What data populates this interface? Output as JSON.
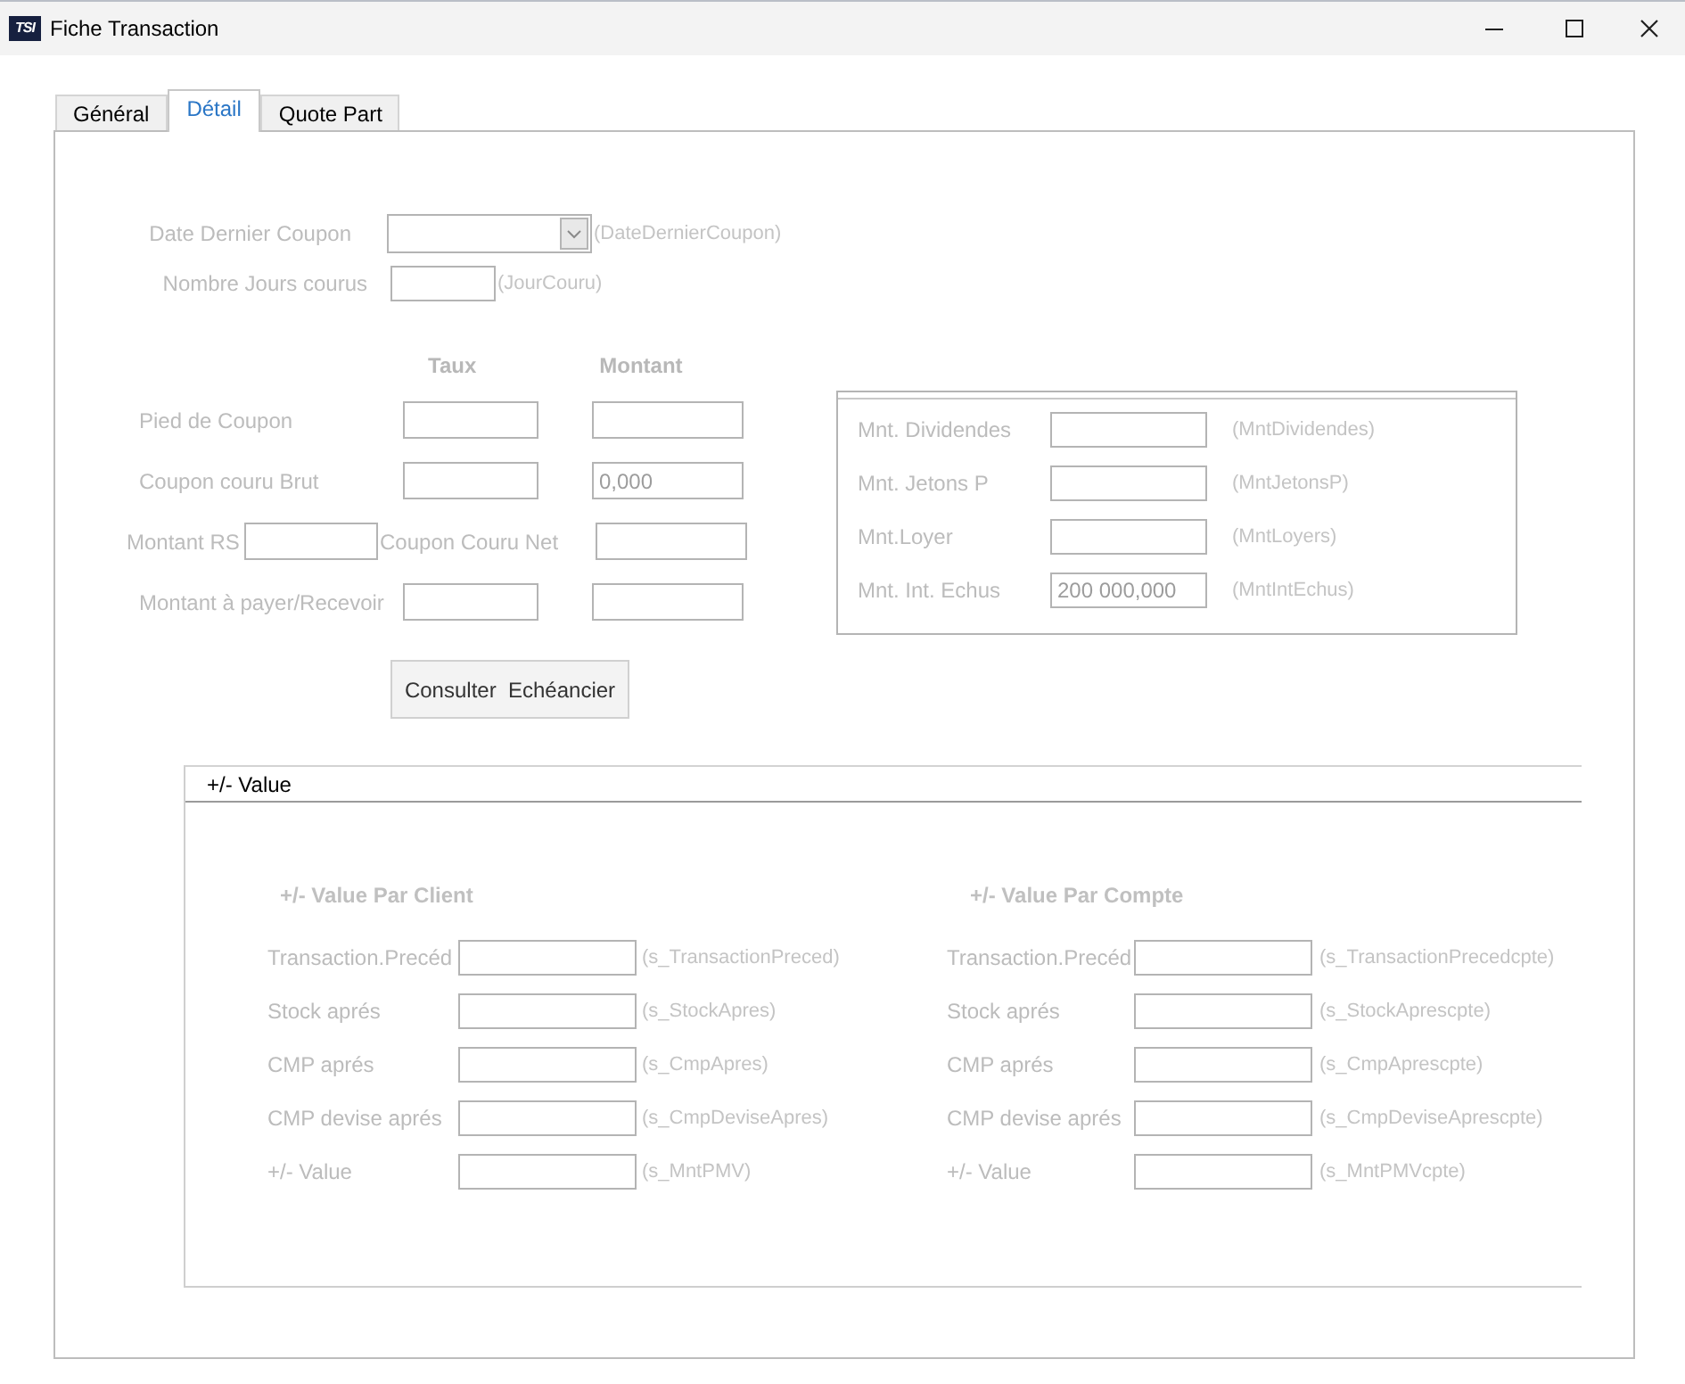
{
  "window": {
    "logo": "TSI",
    "title": "Fiche Transaction"
  },
  "tabs": [
    {
      "label": "Général",
      "selected": false
    },
    {
      "label": "Détail",
      "selected": true
    },
    {
      "label": "Quote Part",
      "selected": false
    }
  ],
  "detail_panel": {
    "disabled": true,
    "date_dernier_coupon": {
      "label": "Date Dernier Coupon",
      "field": {
        "disabled": true
      },
      "hint": "(DateDernierCoupon)"
    },
    "jours_courus": {
      "label": "Nombre Jours courus",
      "field": {
        "disabled": true
      },
      "hint": "(JourCouru)"
    },
    "columns": [
      "Taux",
      "Montant"
    ],
    "coupon_rows": [
      {
        "kind": "standard",
        "label": "Pied de Coupon",
        "field_1": {
          "disabled": true
        },
        "field_2": {
          "disabled": true
        }
      },
      {
        "kind": "standard",
        "label": "Coupon couru Brut",
        "field_1": {
          "disabled": true
        },
        "field_2": {
          "disabled": true,
          "value": "0,000"
        }
      },
      {
        "kind": "split",
        "label": "Montant RS",
        "field_1": {
          "disabled": true
        },
        "label_2": "Coupon Couru Net",
        "field_2": {
          "disabled": true
        }
      },
      {
        "kind": "standard",
        "label": "Montant à payer/Recevoir",
        "field_1": {
          "disabled": true
        },
        "field_2": {
          "disabled": true
        }
      }
    ],
    "consult_button": {
      "label": "Consulter  Echéancier",
      "disabled": false
    },
    "amounts_group": {
      "rows": [
        {
          "label": "Mnt. Dividendes",
          "field": {
            "disabled": true
          },
          "hint": "(MntDividendes)"
        },
        {
          "label": "Mnt. Jetons P",
          "field": {
            "disabled": true
          },
          "hint": "(MntJetonsP)"
        },
        {
          "label": "Mnt.Loyer",
          "field": {
            "disabled": true
          },
          "hint": "(MntLoyers)"
        },
        {
          "label": "Mnt. Int. Echus",
          "field": {
            "disabled": true,
            "value": "200 000,000"
          },
          "hint": "(MntIntEchus)"
        }
      ]
    },
    "value_section": {
      "title": "+/- Value",
      "groups": [
        {
          "title": "+/- Value Par Client",
          "rows": [
            {
              "label": "Transaction.Precéd",
              "field": {
                "disabled": true
              },
              "hint": "(s_TransactionPreced)"
            },
            {
              "label": "Stock aprés",
              "field": {
                "disabled": true
              },
              "hint": "(s_StockApres)"
            },
            {
              "label": "CMP aprés",
              "field": {
                "disabled": true
              },
              "hint": "(s_CmpApres)"
            },
            {
              "label": "CMP devise aprés",
              "field": {
                "disabled": true
              },
              "hint": "(s_CmpDeviseApres)"
            },
            {
              "label": "+/- Value",
              "field": {
                "disabled": true
              },
              "hint": "(s_MntPMV)"
            }
          ]
        },
        {
          "title": "+/- Value Par Compte",
          "rows": [
            {
              "label": "Transaction.Precéd",
              "field": {
                "disabled": true
              },
              "hint": "(s_TransactionPrecedcpte)"
            },
            {
              "label": "Stock aprés",
              "field": {
                "disabled": true
              },
              "hint": "(s_StockAprescpte)"
            },
            {
              "label": "CMP aprés",
              "field": {
                "disabled": true
              },
              "hint": "(s_CmpAprescpte)"
            },
            {
              "label": "CMP devise aprés",
              "field": {
                "disabled": true
              },
              "hint": "(s_CmpDeviseAprescpte)"
            },
            {
              "label": "+/- Value",
              "field": {
                "disabled": true
              },
              "hint": "(s_MntPMVcpte)"
            }
          ]
        }
      ]
    }
  }
}
